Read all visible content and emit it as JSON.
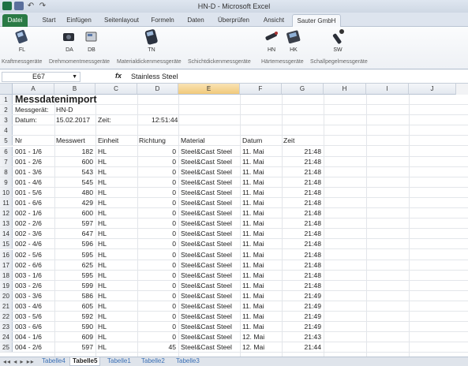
{
  "window": {
    "title": "HN-D  -  Microsoft Excel"
  },
  "ribbon_tabs": [
    {
      "label": "Datei"
    },
    {
      "label": "Start"
    },
    {
      "label": "Einfügen"
    },
    {
      "label": "Seitenlayout"
    },
    {
      "label": "Formeln"
    },
    {
      "label": "Daten"
    },
    {
      "label": "Überprüfen"
    },
    {
      "label": "Ansicht"
    },
    {
      "label": "Sauter GmbH"
    }
  ],
  "ribbon_buttons": [
    {
      "label": "FL"
    },
    {
      "label": "DA"
    },
    {
      "label": "DB"
    },
    {
      "label": "TN"
    },
    {
      "label": "HN"
    },
    {
      "label": "HK"
    },
    {
      "label": "SW"
    }
  ],
  "ribbon_groups": [
    {
      "label": "Kraftmessgeräte"
    },
    {
      "label": "Drehmomentmessgeräte"
    },
    {
      "label": "Materialdickenmessgeräte"
    },
    {
      "label": "Schichtdickenmessgeräte"
    },
    {
      "label": "Härtemessgeräte"
    },
    {
      "label": "Schallpegelmessgeräte"
    }
  ],
  "formula_bar": {
    "name_box": "E67",
    "fx": "fx",
    "value": "Stainless Steel"
  },
  "columns": [
    "A",
    "B",
    "C",
    "D",
    "E",
    "F",
    "G",
    "H",
    "I",
    "J"
  ],
  "header_rows": {
    "title": "Messdatenimport",
    "device_label": "Messgerät:",
    "device_value": "HN-D",
    "date_label": "Datum:",
    "date_value": "15.02.2017",
    "time_label": "Zeit:",
    "time_value": "12:51:44"
  },
  "table_headers": [
    "Nr",
    "Messwert",
    "Einheit",
    "Richtung",
    "Material",
    "Datum",
    "Zeit"
  ],
  "rows": [
    [
      "001 - 1/6",
      "182",
      "HL",
      "0",
      "Steel&Cast Steel",
      "11. Mai",
      "21:48"
    ],
    [
      "001 - 2/6",
      "600",
      "HL",
      "0",
      "Steel&Cast Steel",
      "11. Mai",
      "21:48"
    ],
    [
      "001 - 3/6",
      "543",
      "HL",
      "0",
      "Steel&Cast Steel",
      "11. Mai",
      "21:48"
    ],
    [
      "001 - 4/6",
      "545",
      "HL",
      "0",
      "Steel&Cast Steel",
      "11. Mai",
      "21:48"
    ],
    [
      "001 - 5/6",
      "480",
      "HL",
      "0",
      "Steel&Cast Steel",
      "11. Mai",
      "21:48"
    ],
    [
      "001 - 6/6",
      "429",
      "HL",
      "0",
      "Steel&Cast Steel",
      "11. Mai",
      "21:48"
    ],
    [
      "002 - 1/6",
      "600",
      "HL",
      "0",
      "Steel&Cast Steel",
      "11. Mai",
      "21:48"
    ],
    [
      "002 - 2/6",
      "597",
      "HL",
      "0",
      "Steel&Cast Steel",
      "11. Mai",
      "21:48"
    ],
    [
      "002 - 3/6",
      "647",
      "HL",
      "0",
      "Steel&Cast Steel",
      "11. Mai",
      "21:48"
    ],
    [
      "002 - 4/6",
      "596",
      "HL",
      "0",
      "Steel&Cast Steel",
      "11. Mai",
      "21:48"
    ],
    [
      "002 - 5/6",
      "595",
      "HL",
      "0",
      "Steel&Cast Steel",
      "11. Mai",
      "21:48"
    ],
    [
      "002 - 6/6",
      "625",
      "HL",
      "0",
      "Steel&Cast Steel",
      "11. Mai",
      "21:48"
    ],
    [
      "003 - 1/6",
      "595",
      "HL",
      "0",
      "Steel&Cast Steel",
      "11. Mai",
      "21:48"
    ],
    [
      "003 - 2/6",
      "599",
      "HL",
      "0",
      "Steel&Cast Steel",
      "11. Mai",
      "21:48"
    ],
    [
      "003 - 3/6",
      "586",
      "HL",
      "0",
      "Steel&Cast Steel",
      "11. Mai",
      "21:49"
    ],
    [
      "003 - 4/6",
      "605",
      "HL",
      "0",
      "Steel&Cast Steel",
      "11. Mai",
      "21:49"
    ],
    [
      "003 - 5/6",
      "592",
      "HL",
      "0",
      "Steel&Cast Steel",
      "11. Mai",
      "21:49"
    ],
    [
      "003 - 6/6",
      "590",
      "HL",
      "0",
      "Steel&Cast Steel",
      "11. Mai",
      "21:49"
    ],
    [
      "004 - 1/6",
      "609",
      "HL",
      "0",
      "Steel&Cast Steel",
      "12. Mai",
      "21:43"
    ],
    [
      "004 - 2/6",
      "597",
      "HL",
      "45",
      "Steel&Cast Steel",
      "12. Mai",
      "21:44"
    ]
  ],
  "sheet_tabs": [
    {
      "label": "Tabelle4"
    },
    {
      "label": "Tabelle5"
    },
    {
      "label": "Tabelle1"
    },
    {
      "label": "Tabelle2"
    },
    {
      "label": "Tabelle3"
    }
  ]
}
